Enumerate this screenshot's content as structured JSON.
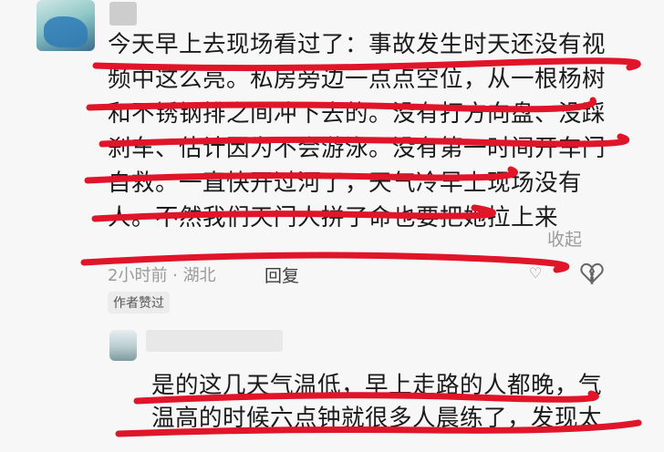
{
  "comment": {
    "lines": [
      "今天早上去现场看过了：事故发生时天还没有视",
      "频中这么亮。私房旁边一点点空位，从一根杨树",
      "和不锈钢排之间冲下去的。没有打方向盘、没踩",
      "刹车、估计因为不会游泳。没有第一时间开车门",
      "自救。一直快开过河了，天气冷早上现场没有",
      "人。不然我们天门人拼了命也要把她拉上来"
    ],
    "collapse_label": "收起",
    "time_location": "2小时前 · 湖北",
    "reply_label": "回复",
    "like_glyph": "♡",
    "author_badge": "作者赞过"
  },
  "reply_comment": {
    "lines": [
      "是的这几天气温低，早上走路的人都晚，气",
      "温高的时候六点钟就很多人晨练了，发现太"
    ]
  },
  "colors": {
    "underline": "#e0152a",
    "text": "#1a1a1a",
    "muted": "#9a9a9a"
  },
  "icons": [
    "user-avatar",
    "broken-heart-icon",
    "heart-icon"
  ]
}
